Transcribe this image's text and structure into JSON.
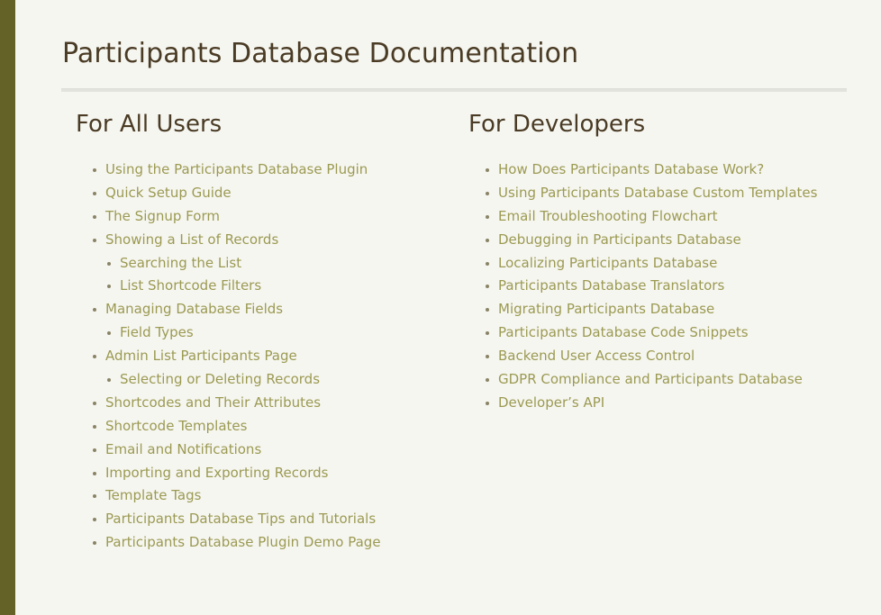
{
  "page": {
    "title": "Participants Database Documentation"
  },
  "colors": {
    "sidebar": "#656228",
    "background": "#f6f6f1",
    "heading": "#4a3b24",
    "link": "#9b9a52"
  },
  "users": {
    "heading": "For All Users",
    "items": [
      {
        "label": "Using the Participants Database Plugin"
      },
      {
        "label": "Quick Setup Guide"
      },
      {
        "label": "The Signup Form"
      },
      {
        "label": "Showing a List of Records"
      },
      {
        "label": "Searching the List"
      },
      {
        "label": "List Shortcode Filters"
      },
      {
        "label": "Managing Database Fields"
      },
      {
        "label": "Field Types"
      },
      {
        "label": "Admin List Participants Page"
      },
      {
        "label": "Selecting or Deleting Records"
      },
      {
        "label": "Shortcodes and Their Attributes"
      },
      {
        "label": "Shortcode Templates"
      },
      {
        "label": "Email and Notifications"
      },
      {
        "label": "Importing and Exporting Records"
      },
      {
        "label": "Template Tags"
      },
      {
        "label": "Participants Database Tips and Tutorials"
      },
      {
        "label": "Participants Database Plugin Demo Page"
      }
    ]
  },
  "developers": {
    "heading": "For Developers",
    "items": [
      {
        "label": "How Does Participants Database Work?"
      },
      {
        "label": "Using Participants Database Custom Templates"
      },
      {
        "label": "Email Troubleshooting Flowchart"
      },
      {
        "label": "Debugging in Participants Database"
      },
      {
        "label": "Localizing Participants Database"
      },
      {
        "label": "Participants Database Translators"
      },
      {
        "label": "Migrating Participants Database"
      },
      {
        "label": "Participants Database Code Snippets"
      },
      {
        "label": "Backend User Access Control"
      },
      {
        "label": "GDPR Compliance and Participants Database"
      },
      {
        "label": "Developer’s API"
      }
    ]
  }
}
